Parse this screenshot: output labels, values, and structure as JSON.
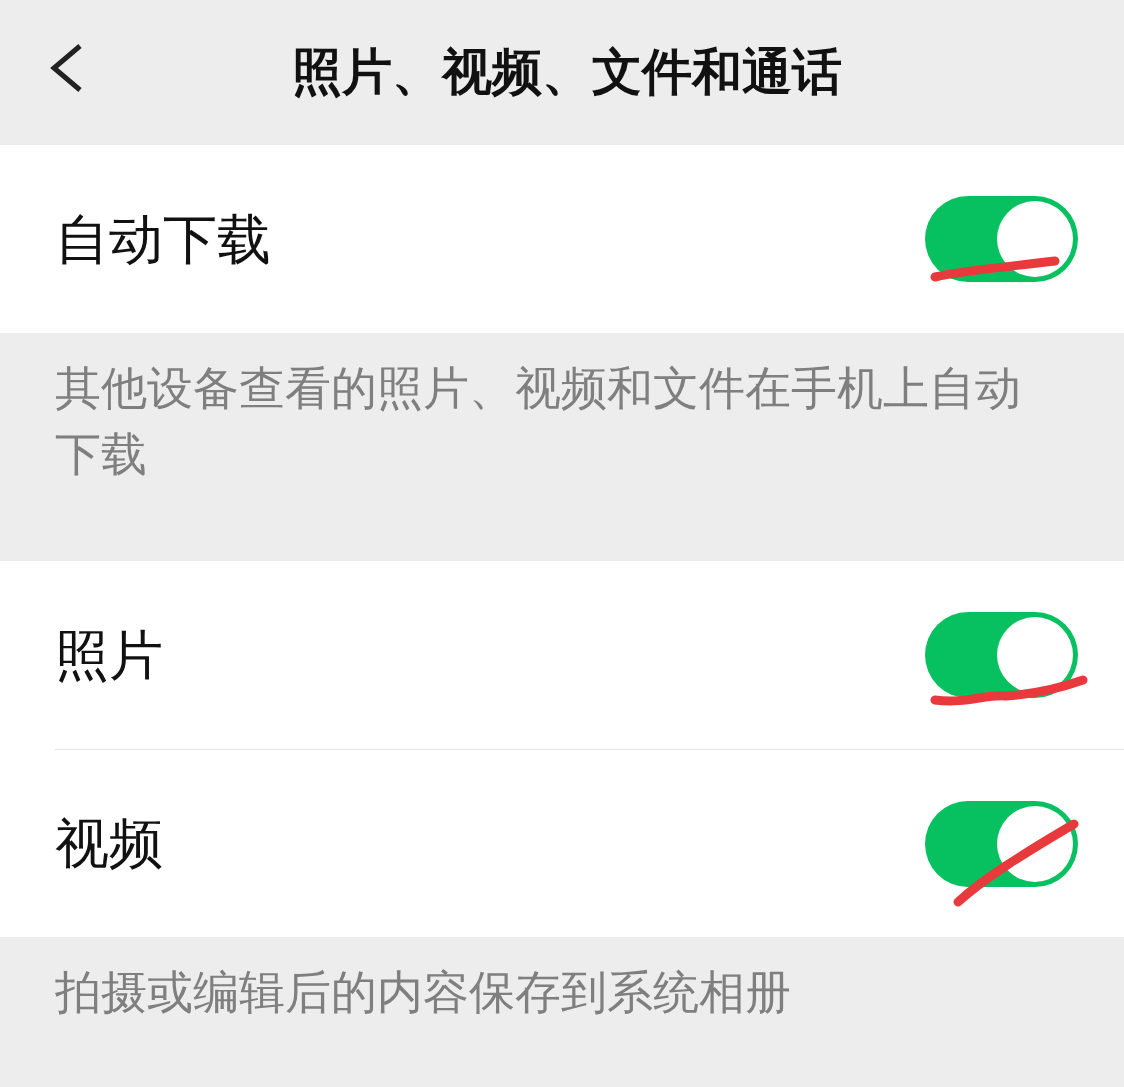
{
  "header": {
    "title": "照片、视频、文件和通话"
  },
  "sections": [
    {
      "rows": [
        {
          "label": "自动下载",
          "on": true
        }
      ],
      "note": "其他设备查看的照片、视频和文件在手机上自动下载"
    },
    {
      "rows": [
        {
          "label": "照片",
          "on": true
        },
        {
          "label": "视频",
          "on": true
        }
      ],
      "note": "拍摄或编辑后的内容保存到系统相册"
    }
  ]
}
